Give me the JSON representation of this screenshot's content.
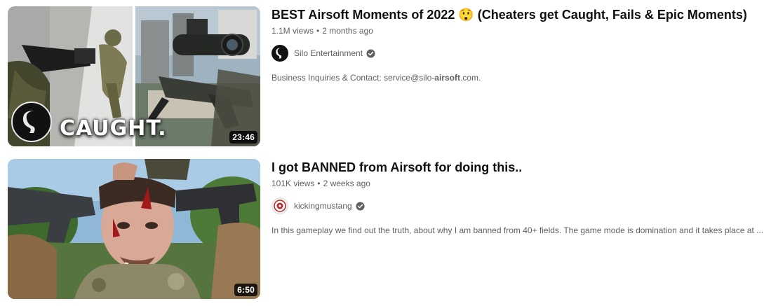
{
  "results": [
    {
      "title": "BEST Airsoft Moments of 2022 😲 (Cheaters get Caught, Fails & Epic Moments)",
      "views": "1.1M views",
      "age": "2 months ago",
      "channel": "Silo Entertainment",
      "verified": true,
      "description_pre": "Business Inquiries & Contact: service@silo-",
      "description_highlight": "airsoft",
      "description_post": ".com.",
      "duration": "23:46",
      "thumbnail_overlay_text": "CAUGHT."
    },
    {
      "title": "I got BANNED from Airsoft for doing this..",
      "views": "101K views",
      "age": "2 weeks ago",
      "channel": "kickingmustang",
      "verified": true,
      "description_pre": "In this gameplay we find out the truth, about why I am banned from 40+ fields. The game mode is domination and it takes place at ...",
      "description_highlight": "",
      "description_post": "",
      "duration": "6:50"
    }
  ],
  "meta_separator": "•",
  "colors": {
    "text_primary": "#0f0f0f",
    "text_secondary": "#606060",
    "duration_bg": "#000000"
  }
}
